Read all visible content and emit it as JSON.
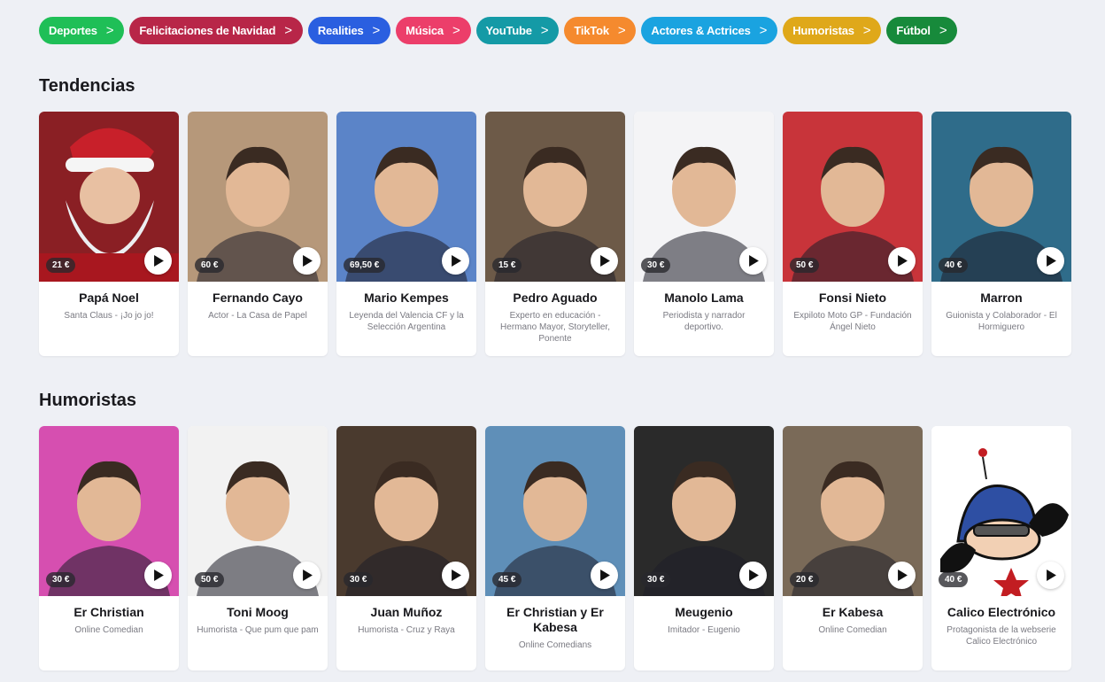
{
  "categories": [
    {
      "label": "Deportes",
      "color": "#1fbf57"
    },
    {
      "label": "Felicitaciones de Navidad",
      "color": "#b82648"
    },
    {
      "label": "Realities",
      "color": "#2a5fe0"
    },
    {
      "label": "Música",
      "color": "#ec3e6a"
    },
    {
      "label": "YouTube",
      "color": "#149aa6"
    },
    {
      "label": "TikTok",
      "color": "#f58a2e"
    },
    {
      "label": "Actores & Actrices",
      "color": "#1aa3e0"
    },
    {
      "label": "Humoristas",
      "color": "#dfa81a"
    },
    {
      "label": "Fútbol",
      "color": "#178a3b"
    }
  ],
  "sections": [
    {
      "title": "Tendencias",
      "cards": [
        {
          "name": "Papá Noel",
          "desc": "Santa Claus - ¡Jo jo jo!",
          "price": "21 €",
          "bg": "#8a1f24",
          "icon": "santa-icon"
        },
        {
          "name": "Fernando Cayo",
          "desc": "Actor - La Casa de Papel",
          "price": "60 €",
          "bg": "#b6987a",
          "icon": "person-icon"
        },
        {
          "name": "Mario Kempes",
          "desc": "Leyenda del Valencia CF y la Selección Argentina",
          "price": "69,50 €",
          "bg": "#5b84c8",
          "icon": "person-icon"
        },
        {
          "name": "Pedro Aguado",
          "desc": "Experto en educación - Hermano Mayor, Storyteller, Ponente",
          "price": "15 €",
          "bg": "#6d5a48",
          "icon": "person-icon"
        },
        {
          "name": "Manolo Lama",
          "desc": "Periodista y narrador deportivo.",
          "price": "30 €",
          "bg": "#f4f4f6",
          "icon": "person-icon"
        },
        {
          "name": "Fonsi Nieto",
          "desc": "Expiloto Moto GP - Fundación Ángel Nieto",
          "price": "50 €",
          "bg": "#c8343a",
          "icon": "person-icon"
        },
        {
          "name": "Marron",
          "desc": "Guionista y Colaborador - El Hormiguero",
          "price": "40 €",
          "bg": "#2f6c8a",
          "icon": "person-icon"
        }
      ]
    },
    {
      "title": "Humoristas",
      "cards": [
        {
          "name": "Er Christian",
          "desc": "Online Comedian",
          "price": "30 €",
          "bg": "#d64fb0",
          "icon": "person-icon"
        },
        {
          "name": "Toni Moog",
          "desc": "Humorista - Que pum que pam",
          "price": "50 €",
          "bg": "#f2f2f2",
          "icon": "person-icon"
        },
        {
          "name": "Juan Muñoz",
          "desc": "Humorista - Cruz y Raya",
          "price": "30 €",
          "bg": "#4a3a2e",
          "icon": "person-icon"
        },
        {
          "name": "Er Christian y Er Kabesa",
          "desc": "Online Comedians",
          "price": "45 €",
          "bg": "#5f8fb8",
          "icon": "person-icon"
        },
        {
          "name": "Meugenio",
          "desc": "Imitador - Eugenio",
          "price": "30 €",
          "bg": "#2a2a2a",
          "icon": "person-icon"
        },
        {
          "name": "Er Kabesa",
          "desc": "Online Comedian",
          "price": "20 €",
          "bg": "#7a6a58",
          "icon": "person-icon"
        },
        {
          "name": "Calico Electrónico",
          "desc": "Protagonista de la webserie Calico Electrónico",
          "price": "40 €",
          "bg": "#ffffff",
          "icon": "cartoon-icon"
        }
      ]
    }
  ]
}
